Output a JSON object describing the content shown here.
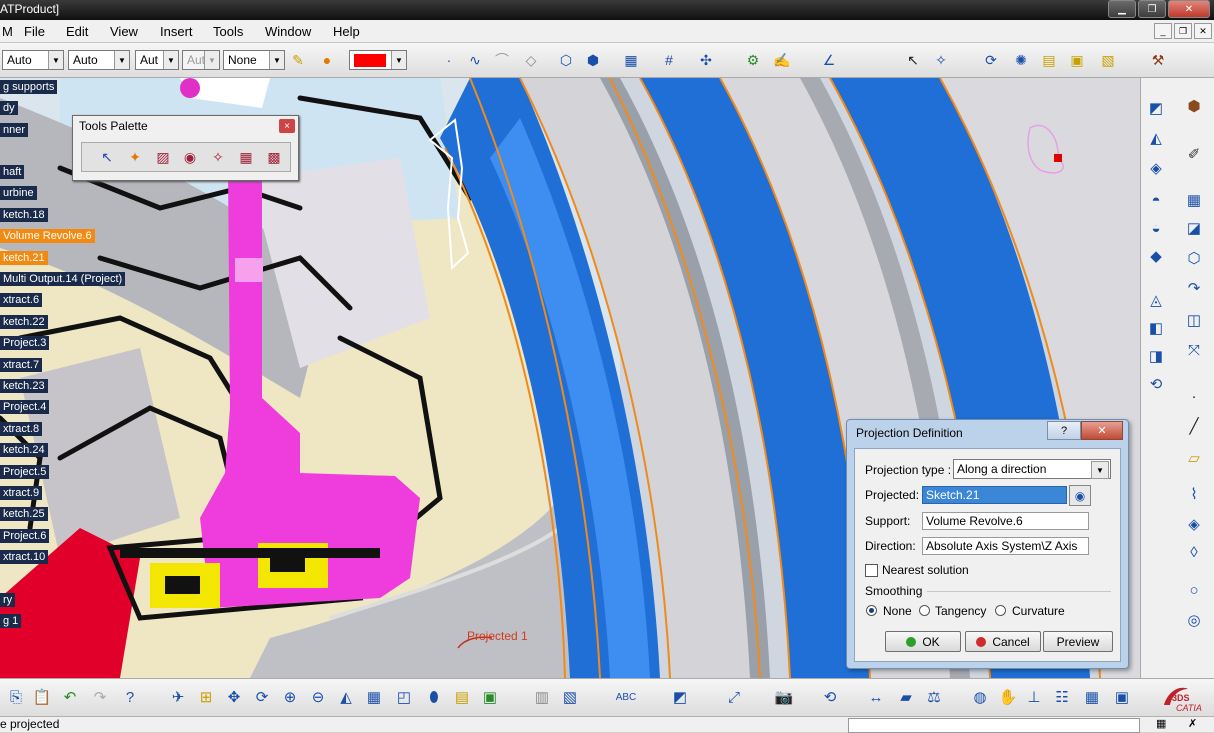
{
  "window": {
    "title": "ATProduct]"
  },
  "menu": [
    "M",
    "File",
    "Edit",
    "View",
    "Insert",
    "Tools",
    "Window",
    "Help"
  ],
  "toolbar": {
    "combo_color_a": "Auto",
    "combo_color_b": "Auto",
    "combo_linewidth": "Aut",
    "combo_linetype": "Aut",
    "combo_layer": "None"
  },
  "tree": [
    "g supports",
    "dy",
    "nner",
    "haft",
    "urbine",
    "ketch.18",
    "Volume Revolve.6",
    "ketch.21",
    "Multi Output.14 (Project)",
    "xtract.6",
    "ketch.22",
    "Project.3",
    "xtract.7",
    "ketch.23",
    "Project.4",
    "xtract.8",
    "ketch.24",
    "Project.5",
    "xtract.9",
    "ketch.25",
    "Project.6",
    "xtract.10",
    "ry",
    "g 1"
  ],
  "tree_selected": [
    "Volume Revolve.6",
    "ketch.21"
  ],
  "palette": {
    "title": "Tools Palette",
    "close": "×"
  },
  "viewport": {
    "annotation": "Projected 1"
  },
  "dialog": {
    "title": "Projection Definition",
    "help": "?",
    "close": "✕",
    "projection_type_label": "Projection type :",
    "projection_type_value": "Along a direction",
    "projected_label": "Projected:",
    "projected_value": "Sketch.21",
    "support_label": "Support:",
    "support_value": "Volume Revolve.6",
    "direction_label": "Direction:",
    "direction_value": "Absolute Axis System\\Z Axis",
    "nearest_label": "Nearest solution",
    "smoothing_label": "Smoothing",
    "radio_none": "None",
    "radio_tangency": "Tangency",
    "radio_curvature": "Curvature",
    "ok": "OK",
    "cancel": "Cancel",
    "preview": "Preview"
  },
  "status": {
    "message": "e projected"
  },
  "brand": {
    "logo_text": "CATIA"
  },
  "colors": {
    "accent_blue": "#1f6fd6",
    "selection_orange": "#f28a12",
    "current_color": "#ff0000"
  }
}
